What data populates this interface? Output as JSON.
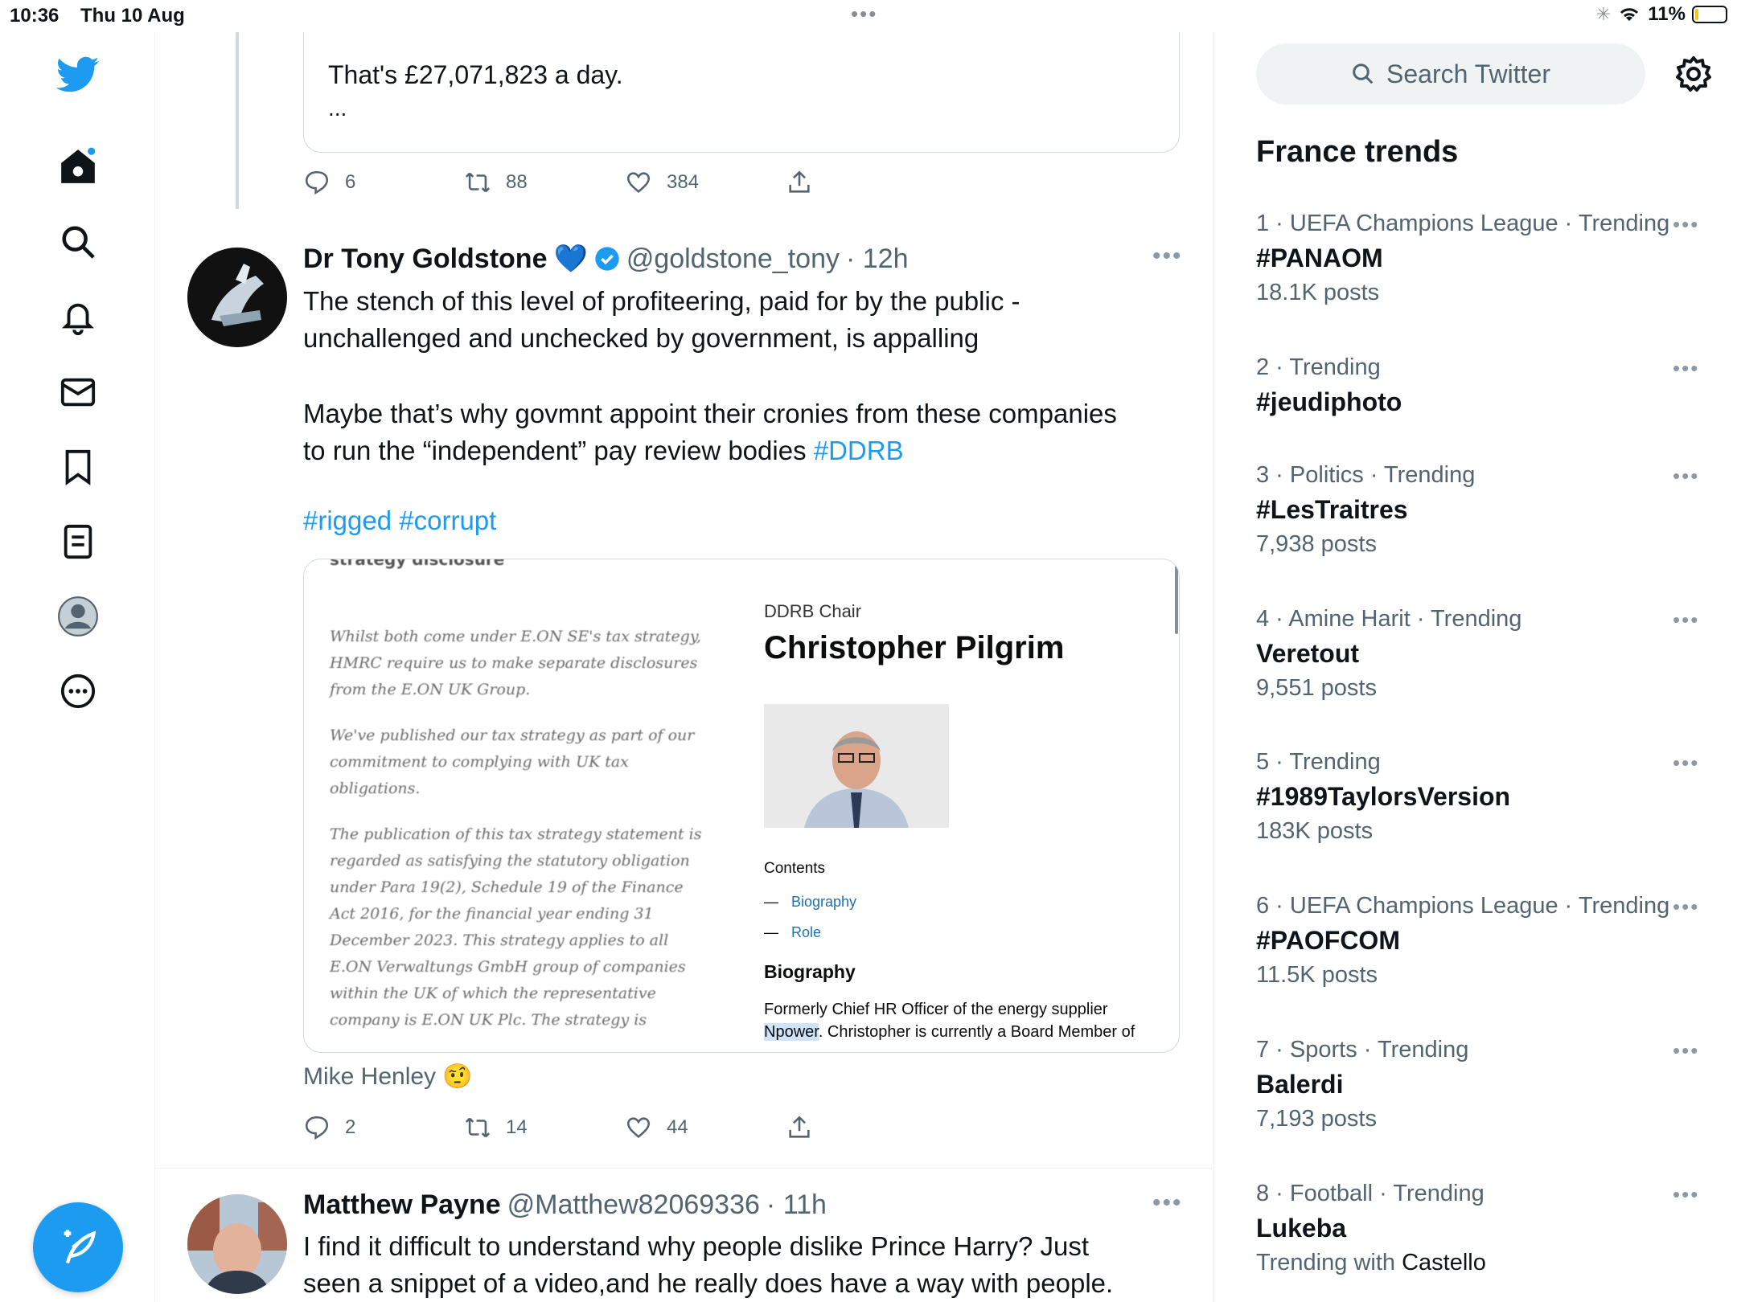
{
  "status_bar": {
    "time": "10:36",
    "date": "Thu 10 Aug",
    "battery": "11%",
    "battery_level_percent": 11
  },
  "left_nav": {
    "items": [
      "twitter-logo",
      "home",
      "explore",
      "notifications",
      "messages",
      "bookmarks",
      "lists",
      "profile",
      "more"
    ]
  },
  "thread": {
    "quote_text": "That's £27,071,823 a day.",
    "quote_more": "...",
    "actions": {
      "replies": "6",
      "retweets": "88",
      "likes": "384"
    }
  },
  "tweet1": {
    "name": "Dr Tony Goldstone",
    "emoji": "💙",
    "handle": "@goldstone_tony",
    "time": "· 12h",
    "line1": "The stench of this level of profiteering, paid for by the public -",
    "line2": "unchallenged and unchecked by government, is appalling",
    "line3": "Maybe that’s why govmnt appoint their cronies from these companies",
    "line4_prefix": "to run the “independent” pay review bodies ",
    "hashtag_ddrb": "#DDRB",
    "hashtag_rigged": "#rigged",
    "hashtag_corrupt": "#corrupt",
    "media": {
      "doc_heading": "strategy disclosure",
      "doc_p1": "Whilst both come under E.ON SE's tax strategy, HMRC require us to make separate disclosures from the E.ON UK Group.",
      "doc_p2": "We've published our tax strategy as part of our commitment to complying with UK tax obligations.",
      "doc_p3": "The publication of this tax strategy statement is regarded as satisfying the statutory obligation under Para 19(2), Schedule 19 of the Finance Act 2016, for the financial year ending 31 December 2023. This strategy applies to all E.ON Verwaltungs GmbH group of companies within the UK of which the representative company is E.ON UK Plc. The strategy is",
      "chair_label": "DDRB Chair",
      "chair_name": "Christopher Pilgrim",
      "contents_heading": "Contents",
      "contents_items": [
        "Biography",
        "Role"
      ],
      "bio_heading": "Biography",
      "bio_line1": "Formerly Chief HR Officer of the energy supplier",
      "bio_selected": "Npower",
      "bio_line2_rest": ". Christopher is currently a Board Member of"
    },
    "mention": "Mike Henley",
    "mention_emoji": "🤨",
    "actions": {
      "replies": "2",
      "retweets": "14",
      "likes": "44"
    }
  },
  "tweet2": {
    "name": "Matthew Payne",
    "handle": "@Matthew82069336",
    "time": "· 11h",
    "line1": "I find it difficult to understand why people dislike Prince Harry? Just",
    "line2": "seen a snippet of a video,and he really does have a way with people."
  },
  "right": {
    "search_placeholder": "Search Twitter",
    "trends_title": "France trends",
    "trends": [
      {
        "meta": "1 · UEFA Champions League · Trending",
        "name": "#PANAOM",
        "count": "18.1K posts"
      },
      {
        "meta": "2 · Trending",
        "name": "#jeudiphoto",
        "count": ""
      },
      {
        "meta": "3 · Politics · Trending",
        "name": "#LesTraitres",
        "count": "7,938 posts"
      },
      {
        "meta": "4 · Amine Harit · Trending",
        "name": "Veretout",
        "count": "9,551 posts"
      },
      {
        "meta": "5 · Trending",
        "name": "#1989TaylorsVersion",
        "count": "183K posts"
      },
      {
        "meta": "6 · UEFA Champions League · Trending",
        "name": "#PAOFCOM",
        "count": "11.5K posts"
      },
      {
        "meta": "7 · Sports · Trending",
        "name": "Balerdi",
        "count": "7,193 posts"
      },
      {
        "meta": "8 · Football · Trending",
        "name": "Lukeba",
        "count_prefix": "Trending with ",
        "count_with": "Castello"
      }
    ]
  },
  "colors": {
    "accent": "#1d9bf0",
    "text": "#0f1419",
    "secondary": "#536471",
    "verified": "#1d9bf0"
  }
}
